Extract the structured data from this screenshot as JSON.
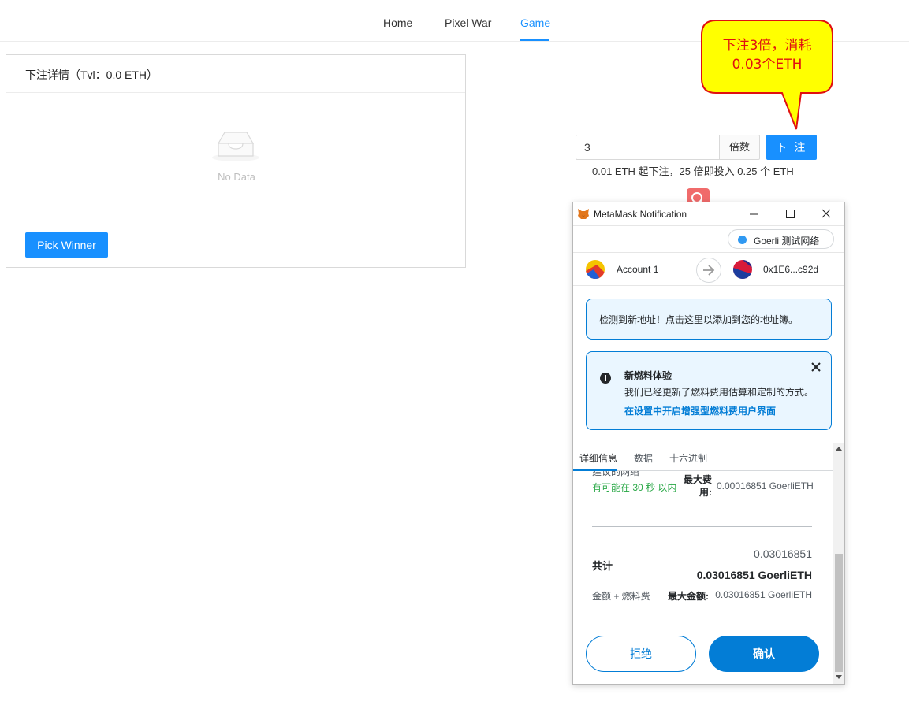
{
  "nav": {
    "items": [
      {
        "label": "Home",
        "active": false
      },
      {
        "label": "Pixel War",
        "active": false
      },
      {
        "label": "Game",
        "active": true
      }
    ],
    "accent": "#1890ff"
  },
  "bet_details": {
    "title": "下注详情（Tvl：0.0 ETH）",
    "empty_text": "No Data",
    "pick_winner_label": "Pick Winner"
  },
  "bet_form": {
    "multiplier_value": "3",
    "addon_label": "倍数",
    "submit_label": "下 注",
    "hint": "0.01 ETH 起下注，25 倍即投入 0.25 个 ETH"
  },
  "callout": {
    "line1": "下注3倍，消耗",
    "line2": "0.03个ETH",
    "fill": "#ffff00",
    "stroke": "#e01010"
  },
  "metamask": {
    "window_title": "MetaMask Notification",
    "network_label": "Goerli 测试网络",
    "from_account": "Account 1",
    "to_address": "0x1E6...c92d",
    "new_address_alert": "检测到新地址！点击这里以添加到您的地址簿。",
    "gas_alert": {
      "title": "新燃料体验",
      "body": "我们已经更新了燃料费用估算和定制的方式。",
      "link": "在设置中开启增强型燃料费用户界面"
    },
    "tabs": [
      {
        "label": "详细信息",
        "active": true
      },
      {
        "label": "数据",
        "active": false
      },
      {
        "label": "十六进制",
        "active": false
      }
    ],
    "details": {
      "cut_label": "建议的网络",
      "likely_text": "有可能在 30 秒 以内",
      "max_fee_label": "最大费用:",
      "max_fee_value": "0.00016851 GoerliETH",
      "total_small": "0.03016851",
      "total_label": "共计",
      "total_big": "0.03016851 GoerliETH",
      "amount_plus_fee": "金额 + 燃料费",
      "max_amount_label": "最大金额:",
      "max_amount_value": "0.03016851 GoerliETH"
    },
    "reject_label": "拒绝",
    "confirm_label": "确认",
    "accent": "#037dd6"
  }
}
